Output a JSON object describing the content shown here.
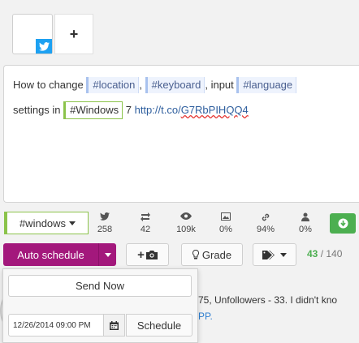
{
  "accounts": {
    "add_label": "+"
  },
  "composer": {
    "line1_prefix": "How to change ",
    "tag_location": "#location",
    "sep1": ",",
    "tag_keyboard": "#keyboard",
    "sep2": ", input",
    "tag_language": "#language",
    "line2_prefix": "settings in ",
    "tag_windows": "#Windows",
    "after_windows": " 7 ",
    "link_prefix": "http://t.co/",
    "link_rest": "G7RbPIHQQ4"
  },
  "toolbar": {
    "hashtag_selector": "#windows",
    "stats": [
      {
        "icon": "twitter-icon",
        "value": "258"
      },
      {
        "icon": "retweet-icon",
        "value": "42"
      },
      {
        "icon": "eye-icon",
        "value": "109k"
      },
      {
        "icon": "image-icon",
        "value": "0%"
      },
      {
        "icon": "link-icon",
        "value": "94%"
      },
      {
        "icon": "user-icon",
        "value": "0%"
      }
    ]
  },
  "actions": {
    "auto_schedule": "Auto schedule",
    "add_photo": "+",
    "grade": "Grade",
    "char_remaining": "43",
    "char_sep": " / ",
    "char_limit": "140"
  },
  "dropdown": {
    "send_now": "Send Now",
    "date_value": "12/26/2014 09:00 PM",
    "schedule": "Schedule"
  },
  "feed": {
    "line1": "75, Unfollowers - 33. I didn't kno",
    "line2": "PP."
  },
  "colors": {
    "accent": "#a3187c",
    "green": "#4caf50",
    "hashtag_bg": "#eef3fd",
    "twitter": "#1da1f2"
  }
}
